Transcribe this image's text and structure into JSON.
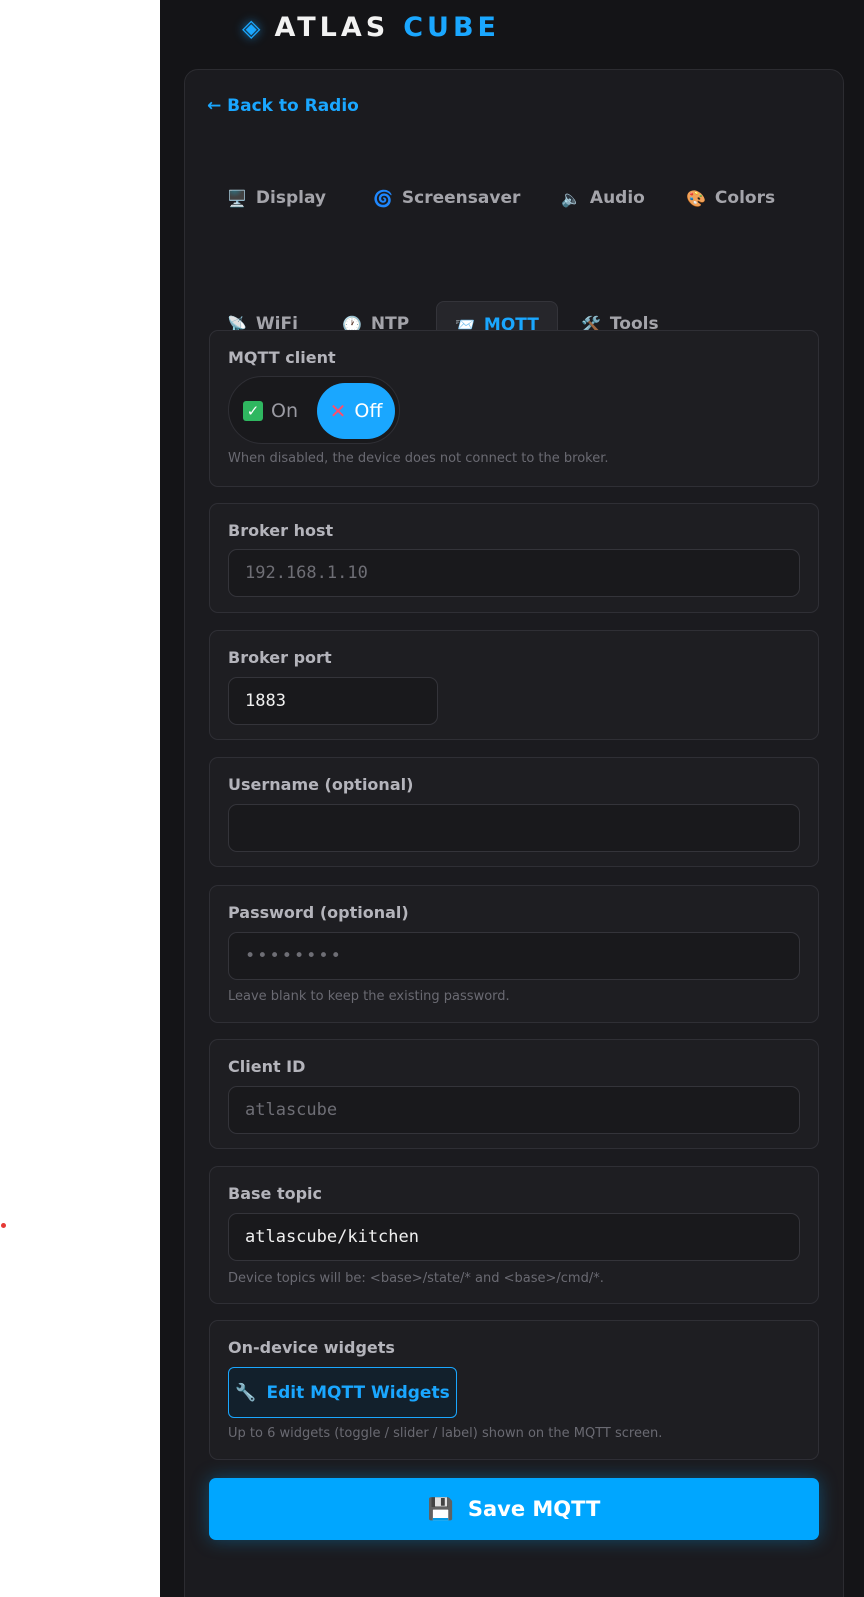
{
  "brand": {
    "logo": "◈",
    "word1": "ATLAS",
    "word2": "CUBE"
  },
  "back_link": "← Back to Radio",
  "tabs": [
    {
      "icon": "🖥️",
      "label": "Display"
    },
    {
      "icon": "🌀",
      "label": "Screensaver"
    },
    {
      "icon": "🔈",
      "label": "Audio"
    },
    {
      "icon": "🎨",
      "label": "Colors"
    },
    {
      "icon": "📡",
      "label": "WiFi"
    },
    {
      "icon": "🕐",
      "label": "NTP"
    },
    {
      "icon": "📨",
      "label": "MQTT",
      "active": true
    },
    {
      "icon": "🛠️",
      "label": "Tools"
    }
  ],
  "mqtt_client": {
    "label": "MQTT client",
    "on_label": "On",
    "off_label": "Off",
    "selected": "Off",
    "hint": "When disabled, the device does not connect to the broker."
  },
  "broker_host": {
    "label": "Broker host",
    "placeholder": "192.168.1.10",
    "value": ""
  },
  "broker_port": {
    "label": "Broker port",
    "value": "1883"
  },
  "username": {
    "label": "Username (optional)",
    "value": ""
  },
  "password": {
    "label": "Password (optional)",
    "placeholder": "••••••••",
    "hint": "Leave blank to keep the existing password."
  },
  "client_id": {
    "label": "Client ID",
    "placeholder": "atlascube"
  },
  "base_topic": {
    "label": "Base topic",
    "value": "atlascube/kitchen",
    "hint": "Device topics will be: <base>/state/* and <base>/cmd/*."
  },
  "widgets": {
    "label": "On-device widgets",
    "button_icon": "🔧",
    "button_label": "Edit MQTT Widgets",
    "hint": "Up to 6 widgets (toggle / slider / label) shown on the MQTT screen."
  },
  "save": {
    "icon": "💾",
    "label": "Save MQTT"
  },
  "colors": {
    "accent": "#1aa7ff",
    "background": "#141417",
    "card": "#1b1b1f"
  }
}
